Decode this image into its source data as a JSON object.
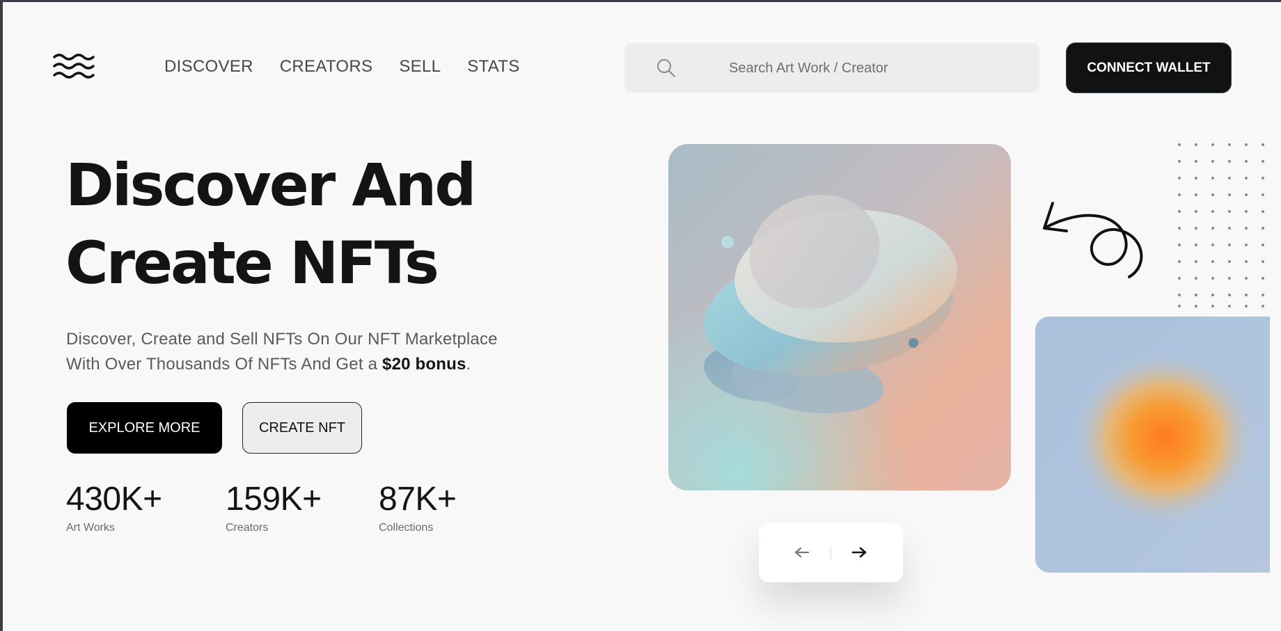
{
  "nav": {
    "items": [
      {
        "label": "DISCOVER"
      },
      {
        "label": "CREATORS"
      },
      {
        "label": "SELL"
      },
      {
        "label": "STATS"
      }
    ]
  },
  "search": {
    "placeholder": "Search Art Work / Creator"
  },
  "header": {
    "connect_wallet_label": "CONNECT WALLET"
  },
  "hero": {
    "title_line1": "Discover And",
    "title_line2": "Create NFTs",
    "description_part1": "Discover, Create and Sell NFTs On Our NFT Marketplace With Over Thousands Of NFTs And Get a ",
    "description_bold": "$20 bonus",
    "description_end": ".",
    "explore_label": "EXPLORE MORE",
    "create_label": "CREATE NFT"
  },
  "stats": [
    {
      "value": "430K+",
      "label": "Art Works"
    },
    {
      "value": "159K+",
      "label": "Creators"
    },
    {
      "value": "87K+",
      "label": "Collections"
    }
  ],
  "icons": {
    "logo": "waves-logo-icon",
    "search": "search-icon",
    "prev": "arrow-left-icon",
    "next": "arrow-right-icon"
  },
  "colors": {
    "background": "#f8f8f8",
    "primary_button": "#000000",
    "text_dark": "#141414",
    "text_muted": "#5a5a5a"
  }
}
